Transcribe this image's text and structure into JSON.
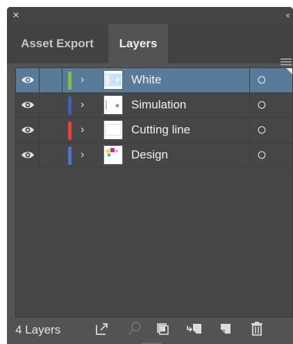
{
  "window": {
    "close_icon": "close-icon",
    "collapse_glyph": "‹‹"
  },
  "tabs": [
    {
      "label": "Asset Export",
      "active": false
    },
    {
      "label": "Layers",
      "active": true
    }
  ],
  "layers": [
    {
      "name": "White",
      "color": "#7ac143",
      "selected": true,
      "thumbnail": "white-layer-thumbnail"
    },
    {
      "name": "Simulation",
      "color": "#3f5fbf",
      "selected": false,
      "thumbnail": "simulation-layer-thumbnail"
    },
    {
      "name": "Cutting line",
      "color": "#e8423f",
      "selected": false,
      "thumbnail": "cutting-line-layer-thumbnail"
    },
    {
      "name": "Design",
      "color": "#4f73c8",
      "selected": false,
      "thumbnail": "design-layer-thumbnail"
    }
  ],
  "footer": {
    "layer_count": "4 Layers",
    "icons": [
      "export-icon",
      "locate-object-icon",
      "clipping-mask-icon",
      "new-sublayer-icon",
      "new-layer-icon",
      "delete-icon"
    ]
  },
  "colors": {
    "panel_bg": "#535353",
    "selection": "#5a7a99"
  }
}
